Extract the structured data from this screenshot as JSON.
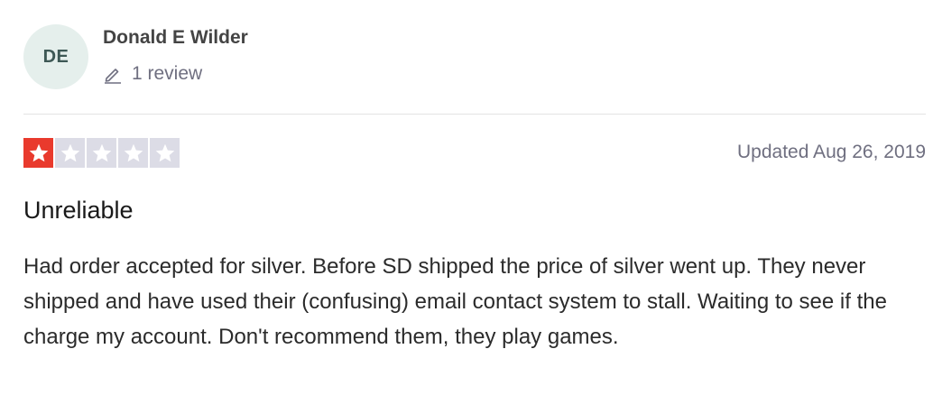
{
  "reviewer": {
    "initials": "DE",
    "name": "Donald E Wilder",
    "review_count": "1 review",
    "avatar_bg": "#e5efec"
  },
  "rating": {
    "value": 1,
    "max": 5,
    "filled_color": "#e93a2d",
    "empty_color": "#dcdce6"
  },
  "review": {
    "date": "Updated Aug 26, 2019",
    "title": "Unreliable",
    "body": "Had order accepted for silver. Before SD shipped the price of silver went up. They never shipped and have used their (confusing) email contact system to stall. Waiting to see if the charge my account. Don't recommend them, they play games."
  }
}
